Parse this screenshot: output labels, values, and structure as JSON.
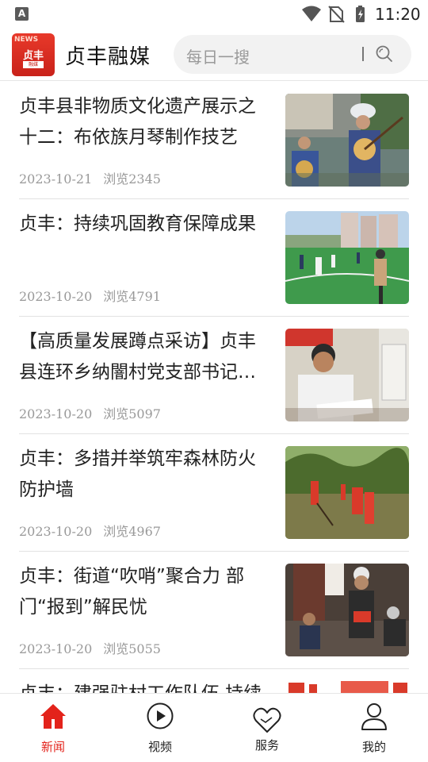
{
  "status_bar": {
    "notification_glyph": "A",
    "time": "11:20"
  },
  "header": {
    "logo": {
      "badge": "NEWS",
      "main": "贞丰",
      "sub": "融媒"
    },
    "title": "贞丰融媒",
    "search_placeholder": "每日一搜"
  },
  "articles": [
    {
      "title": "贞丰县非物质文化遗产展示之十二：布依族月琴制作技艺",
      "date": "2023-10-21",
      "views": "浏览2345"
    },
    {
      "title": "贞丰：持续巩固教育保障成果",
      "date": "2023-10-20",
      "views": "浏览4791"
    },
    {
      "title": "【高质量发展蹲点采访】贞丰县连环乡纳闇村党支部书记…",
      "date": "2023-10-20",
      "views": "浏览5097"
    },
    {
      "title": "贞丰：多措并举筑牢森林防火防护墙",
      "date": "2023-10-20",
      "views": "浏览4967"
    },
    {
      "title": "贞丰：街道“吹哨”聚合力 部门“报到”解民忧",
      "date": "2023-10-20",
      "views": "浏览5055"
    },
    {
      "title": "贞丰：建强驻村工作队伍 持续",
      "date": "",
      "views": ""
    }
  ],
  "bottom_nav": [
    {
      "label": "新闻",
      "icon": "home-icon",
      "active": true
    },
    {
      "label": "视频",
      "icon": "play-circle-icon",
      "active": false
    },
    {
      "label": "服务",
      "icon": "heart-hands-icon",
      "active": false
    },
    {
      "label": "我的",
      "icon": "user-icon",
      "active": false
    }
  ],
  "colors": {
    "accent": "#e3231b",
    "meta_text": "#999999",
    "search_bg": "#f2f2f2"
  }
}
